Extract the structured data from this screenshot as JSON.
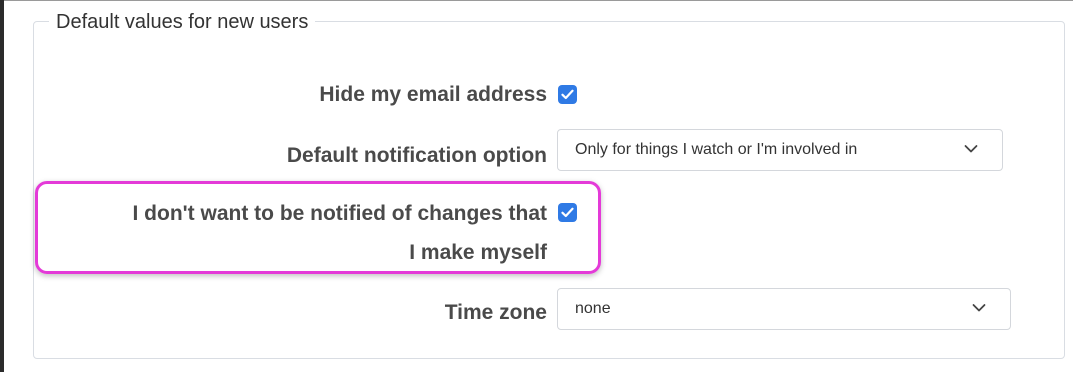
{
  "section": {
    "legend": "Default values for new users"
  },
  "fields": {
    "hide_email": {
      "label": "Hide my email address",
      "checked": true
    },
    "notification": {
      "label": "Default notification option",
      "selected": "Only for things I watch or I'm involved in"
    },
    "no_self_notify": {
      "label_line1": "I don't want to be notified of changes that",
      "label_line2": "I make myself",
      "checked": true
    },
    "time_zone": {
      "label": "Time zone",
      "selected": "none"
    }
  },
  "icons": {
    "checkbox_check": "check-icon",
    "dropdown": "chevron-down-icon"
  },
  "colors": {
    "checkbox": "#2f7ae5",
    "highlight": "#e43ad8",
    "label": "#4a4a4a"
  }
}
